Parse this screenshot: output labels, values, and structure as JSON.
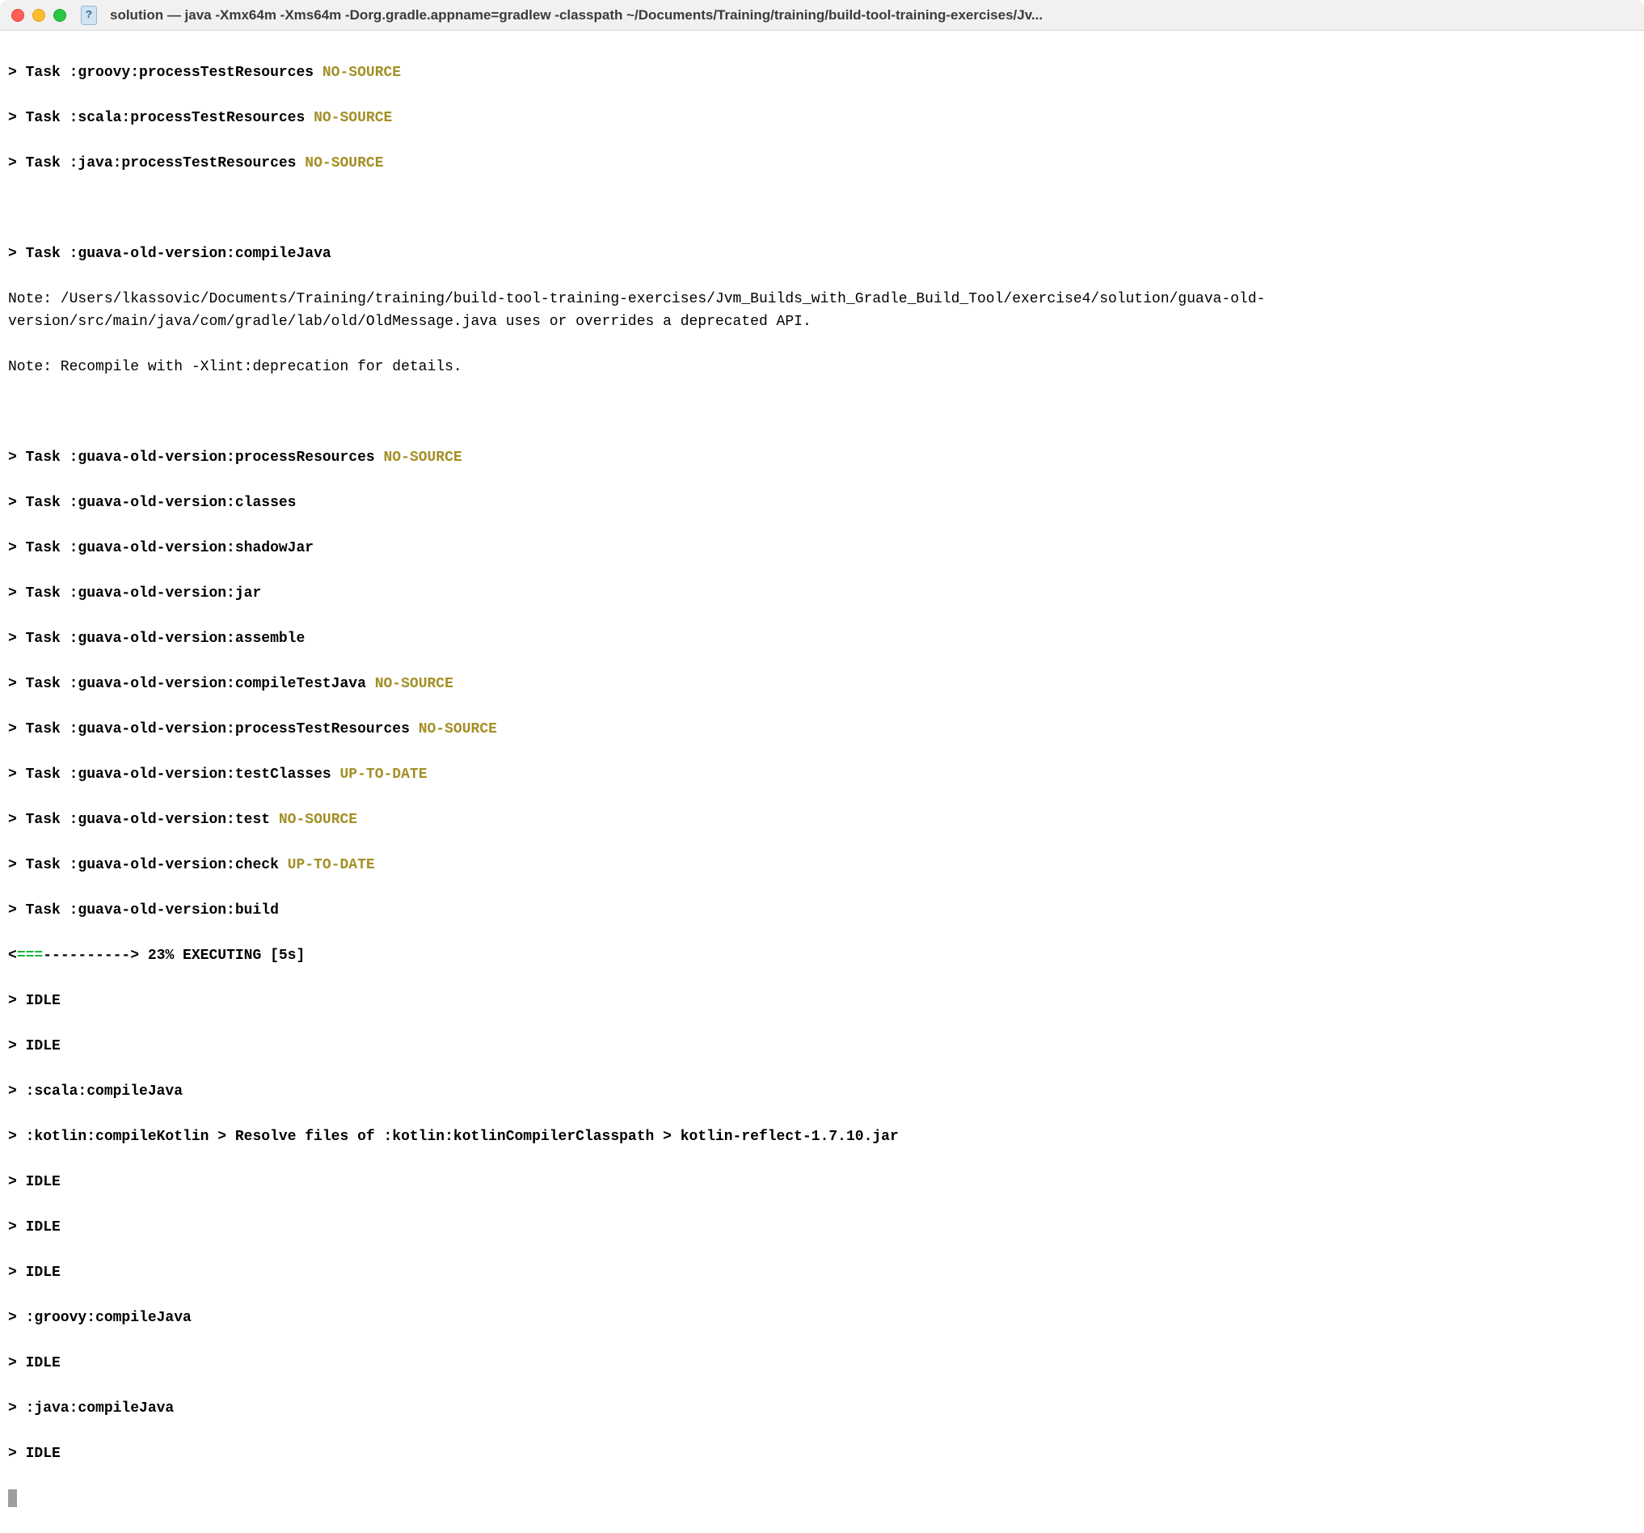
{
  "window": {
    "title": "solution — java -Xmx64m -Xms64m -Dorg.gradle.appname=gradlew -classpath ~/Documents/Training/training/build-tool-training-exercises/Jv..."
  },
  "tasks_top": [
    {
      "prefix": "> Task ",
      "name": ":groovy:processTestResources",
      "status": " NO-SOURCE"
    },
    {
      "prefix": "> Task ",
      "name": ":scala:processTestResources",
      "status": " NO-SOURCE"
    },
    {
      "prefix": "> Task ",
      "name": ":java:processTestResources",
      "status": " NO-SOURCE"
    }
  ],
  "compile_task": {
    "prefix": "> Task ",
    "name": ":guava-old-version:compileJava"
  },
  "note1": "Note: /Users/lkassovic/Documents/Training/training/build-tool-training-exercises/Jvm_Builds_with_Gradle_Build_Tool/exercise4/solution/guava-old-version/src/main/java/com/gradle/lab/old/OldMessage.java uses or overrides a deprecated API.",
  "note2": "Note: Recompile with -Xlint:deprecation for details.",
  "tasks_mid": [
    {
      "prefix": "> Task ",
      "name": ":guava-old-version:processResources",
      "status": " NO-SOURCE"
    },
    {
      "prefix": "> Task ",
      "name": ":guava-old-version:classes",
      "status": ""
    },
    {
      "prefix": "> Task ",
      "name": ":guava-old-version:shadowJar",
      "status": ""
    },
    {
      "prefix": "> Task ",
      "name": ":guava-old-version:jar",
      "status": ""
    },
    {
      "prefix": "> Task ",
      "name": ":guava-old-version:assemble",
      "status": ""
    },
    {
      "prefix": "> Task ",
      "name": ":guava-old-version:compileTestJava",
      "status": " NO-SOURCE"
    },
    {
      "prefix": "> Task ",
      "name": ":guava-old-version:processTestResources",
      "status": " NO-SOURCE"
    },
    {
      "prefix": "> Task ",
      "name": ":guava-old-version:testClasses",
      "status": " UP-TO-DATE"
    },
    {
      "prefix": "> Task ",
      "name": ":guava-old-version:test",
      "status": " NO-SOURCE"
    },
    {
      "prefix": "> Task ",
      "name": ":guava-old-version:check",
      "status": " UP-TO-DATE"
    },
    {
      "prefix": "> Task ",
      "name": ":guava-old-version:build",
      "status": ""
    }
  ],
  "progress": {
    "open": "<",
    "bar_fill": "===",
    "bar_empty": "---------->",
    "label": " 23% EXECUTING [5s]"
  },
  "workers": [
    "> IDLE",
    "> IDLE",
    "> :scala:compileJava",
    "> :kotlin:compileKotlin > Resolve files of :kotlin:kotlinCompilerClasspath > kotlin-reflect-1.7.10.jar",
    "> IDLE",
    "> IDLE",
    "> IDLE",
    "> :groovy:compileJava",
    "> IDLE",
    "> :java:compileJava",
    "> IDLE"
  ]
}
